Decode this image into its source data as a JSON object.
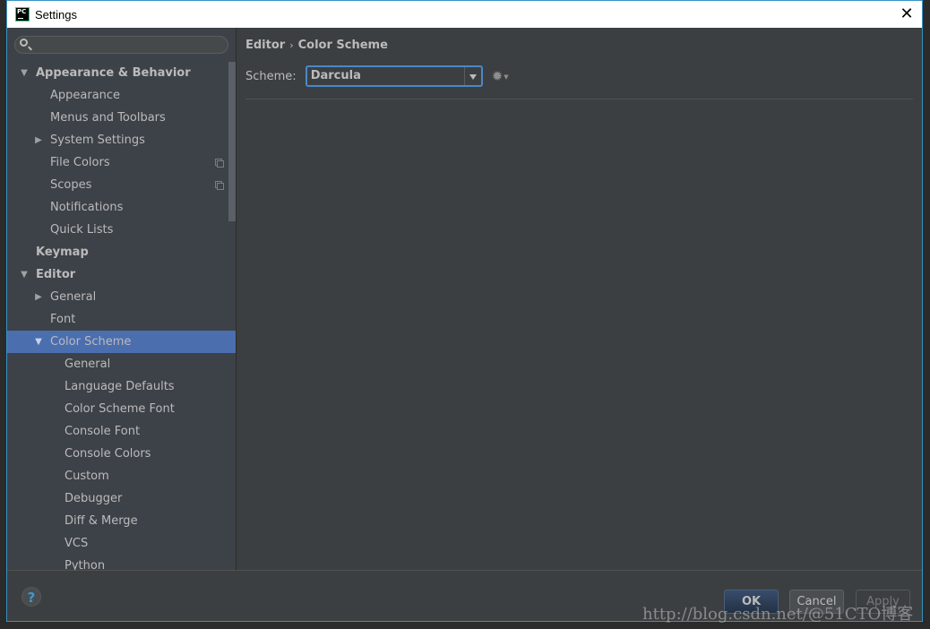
{
  "window": {
    "title": "Settings",
    "app_icon_text": "PC",
    "close_glyph": "✕"
  },
  "search": {
    "placeholder": "",
    "value": ""
  },
  "tree": [
    {
      "label": "Appearance & Behavior",
      "level": 0,
      "bold": true,
      "arrow": "expanded"
    },
    {
      "label": "Appearance",
      "level": 1
    },
    {
      "label": "Menus and Toolbars",
      "level": 1
    },
    {
      "label": "System Settings",
      "level": 1,
      "arrow": "collapsed"
    },
    {
      "label": "File Colors",
      "level": 1,
      "copy_icon": true
    },
    {
      "label": "Scopes",
      "level": 1,
      "copy_icon": true
    },
    {
      "label": "Notifications",
      "level": 1
    },
    {
      "label": "Quick Lists",
      "level": 1
    },
    {
      "label": "Keymap",
      "level": 0,
      "bold": true
    },
    {
      "label": "Editor",
      "level": 0,
      "bold": true,
      "arrow": "expanded"
    },
    {
      "label": "General",
      "level": 1,
      "arrow": "collapsed"
    },
    {
      "label": "Font",
      "level": 1
    },
    {
      "label": "Color Scheme",
      "level": 1,
      "arrow": "expanded",
      "selected": true
    },
    {
      "label": "General",
      "level": 2
    },
    {
      "label": "Language Defaults",
      "level": 2
    },
    {
      "label": "Color Scheme Font",
      "level": 2
    },
    {
      "label": "Console Font",
      "level": 2
    },
    {
      "label": "Console Colors",
      "level": 2
    },
    {
      "label": "Custom",
      "level": 2
    },
    {
      "label": "Debugger",
      "level": 2
    },
    {
      "label": "Diff & Merge",
      "level": 2
    },
    {
      "label": "VCS",
      "level": 2
    },
    {
      "label": "Python",
      "level": 2
    }
  ],
  "content": {
    "breadcrumb": {
      "parent": "Editor",
      "separator": "›",
      "current": "Color Scheme"
    },
    "scheme_label": "Scheme:",
    "scheme_value": "Darcula",
    "gear_glyph": "✹",
    "gear_caret": "▼"
  },
  "footer": {
    "help_glyph": "?",
    "ok_label": "OK",
    "cancel_label": "Cancel",
    "apply_label": "Apply"
  },
  "watermark": "http://blog.csdn.net/@51CTO博客",
  "colors": {
    "selection": "#4b6eaf",
    "focus_border": "#4a88c7",
    "window_border": "#3592c4",
    "help_icon": "#3d9ad1"
  }
}
